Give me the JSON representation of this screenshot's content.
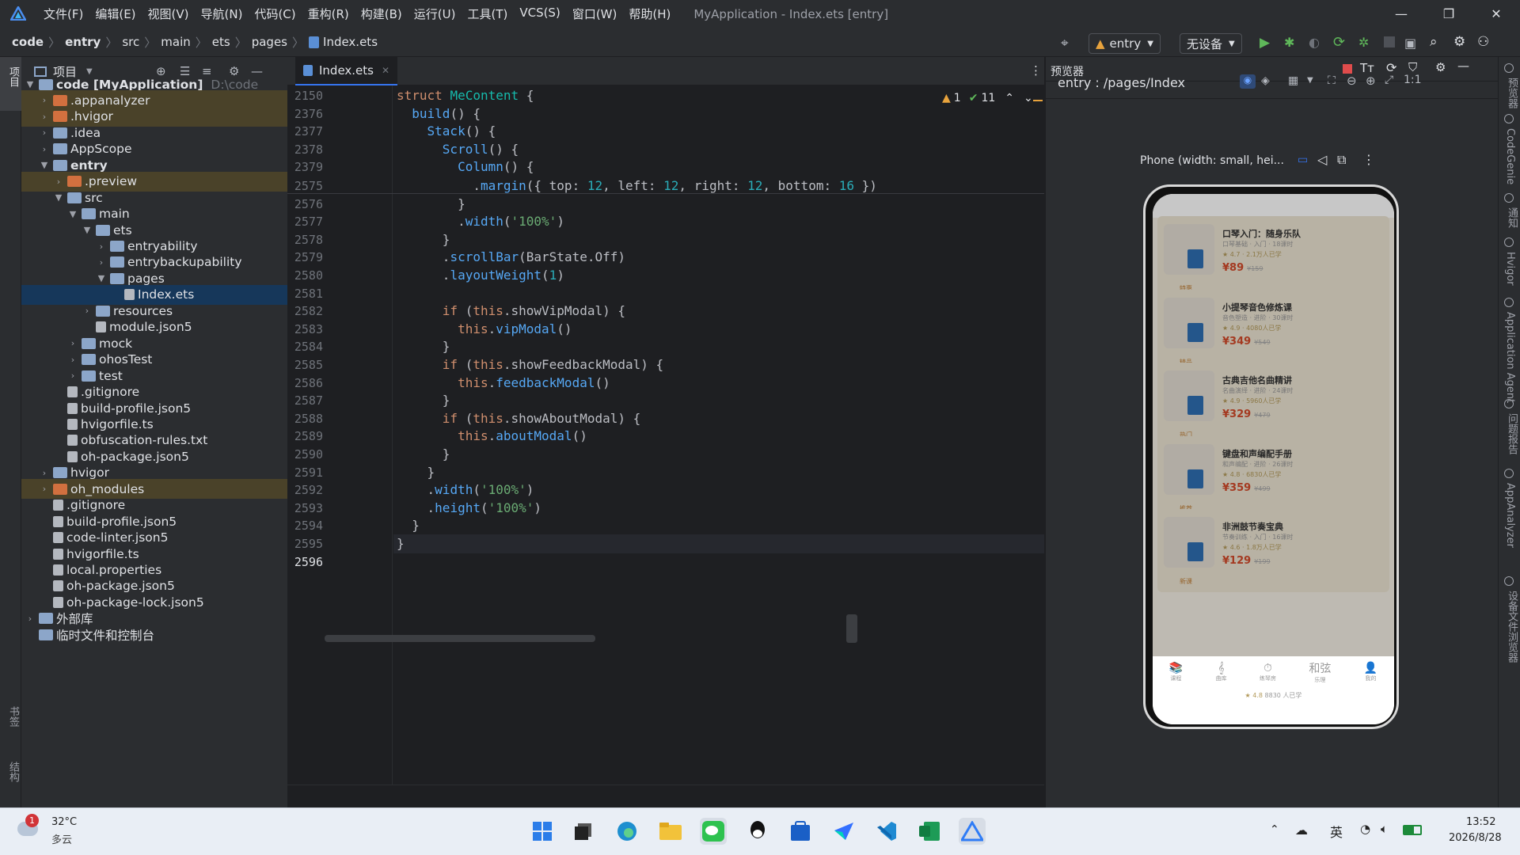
{
  "app": {
    "menus": [
      "文件(F)",
      "编辑(E)",
      "视图(V)",
      "导航(N)",
      "代码(C)",
      "重构(R)",
      "构建(B)",
      "运行(U)",
      "工具(T)",
      "VCS(S)",
      "窗口(W)",
      "帮助(H)"
    ],
    "window_title": "MyApplication - Index.ets [entry]",
    "breadcrumbs": [
      "code",
      "entry",
      "src",
      "main",
      "ets",
      "pages",
      "Index.ets"
    ],
    "run_config": "entry",
    "device": "无设备"
  },
  "project": {
    "title": "项目",
    "items": [
      {
        "label": "code [MyApplication]",
        "extra": "D:\\code"
      },
      {
        "label": ".appanalyzer"
      },
      {
        "label": ".hvigor"
      },
      {
        "label": ".idea"
      },
      {
        "label": "AppScope"
      },
      {
        "label": "entry"
      },
      {
        "label": ".preview"
      },
      {
        "label": "src"
      },
      {
        "label": "main"
      },
      {
        "label": "ets"
      },
      {
        "label": "entryability"
      },
      {
        "label": "entrybackupability"
      },
      {
        "label": "pages"
      },
      {
        "label": "Index.ets"
      },
      {
        "label": "resources"
      },
      {
        "label": "module.json5"
      },
      {
        "label": "mock"
      },
      {
        "label": "ohosTest"
      },
      {
        "label": "test"
      },
      {
        "label": ".gitignore"
      },
      {
        "label": "build-profile.json5"
      },
      {
        "label": "hvigorfile.ts"
      },
      {
        "label": "obfuscation-rules.txt"
      },
      {
        "label": "oh-package.json5"
      },
      {
        "label": "hvigor"
      },
      {
        "label": "oh_modules"
      },
      {
        "label": ".gitignore"
      },
      {
        "label": "build-profile.json5"
      },
      {
        "label": "code-linter.json5"
      },
      {
        "label": "hvigorfile.ts"
      },
      {
        "label": "local.properties"
      },
      {
        "label": "oh-package.json5"
      },
      {
        "label": "oh-package-lock.json5"
      },
      {
        "label": "外部库"
      },
      {
        "label": "临时文件和控制台"
      }
    ]
  },
  "editor": {
    "tab": "Index.ets",
    "warnings": "1",
    "checks": "11",
    "line_numbers": [
      "2150",
      "2376",
      "2377",
      "2378",
      "2379",
      "2575",
      "2576",
      "2577",
      "2578",
      "2579",
      "2580",
      "2581",
      "2582",
      "2583",
      "2584",
      "2585",
      "2586",
      "2587",
      "2588",
      "2589",
      "2590",
      "2591",
      "2592",
      "2593",
      "2594",
      "2595",
      "2596"
    ]
  },
  "previewer": {
    "title": "预览器",
    "path": "entry : /pages/Index",
    "device_label": "Phone (width: small, hei...",
    "cards": [
      {
        "title": "口琴入门：随身乐队",
        "sub": "口琴基础 · 入门 · 18课时",
        "rating": "★ 4.7 · 2.1万人已学",
        "price": "¥89",
        "old": "¥159",
        "tag": "特惠"
      },
      {
        "title": "小提琴音色修炼课",
        "sub": "音色塑造 · 进阶 · 30课时",
        "rating": "★ 4.9 · 4080人已学",
        "price": "¥349",
        "old": "¥549",
        "tag": "精品"
      },
      {
        "title": "古典吉他名曲精讲",
        "sub": "名曲演绎 · 进阶 · 24课时",
        "rating": "★ 4.9 · 5960人已学",
        "price": "¥329",
        "old": "¥479",
        "tag": "热门"
      },
      {
        "title": "键盘和声编配手册",
        "sub": "和声编配 · 进阶 · 26课时",
        "rating": "★ 4.8 · 6830人已学",
        "price": "¥359",
        "old": "¥499",
        "tag": "推荐"
      },
      {
        "title": "非洲鼓节奏宝典",
        "sub": "节奏训练 · 入门 · 16课时",
        "rating": "★ 4.6 · 1.8万人已学",
        "price": "¥129",
        "old": "¥199",
        "tag": "新课"
      }
    ],
    "tabs": [
      "课程",
      "曲库",
      "练琴房",
      "乐理",
      "我的"
    ],
    "logo": "和弦",
    "bottom_rating": "★ 4.8",
    "bottom_learners": "8830 人已学"
  },
  "side_tools": [
    "预览器",
    "CodeGenie",
    "通知",
    "Hvigor",
    "Application Agent",
    "问题报告",
    "AppAnalyzer",
    "设备文件浏览器"
  ],
  "left_tools": [
    "项目",
    "书签",
    "结构"
  ],
  "taskbar": {
    "weather_badge": "1",
    "temp": "32°C",
    "weather": "多云",
    "ime": "英",
    "time": "13:52",
    "date": "2026/8/28"
  }
}
